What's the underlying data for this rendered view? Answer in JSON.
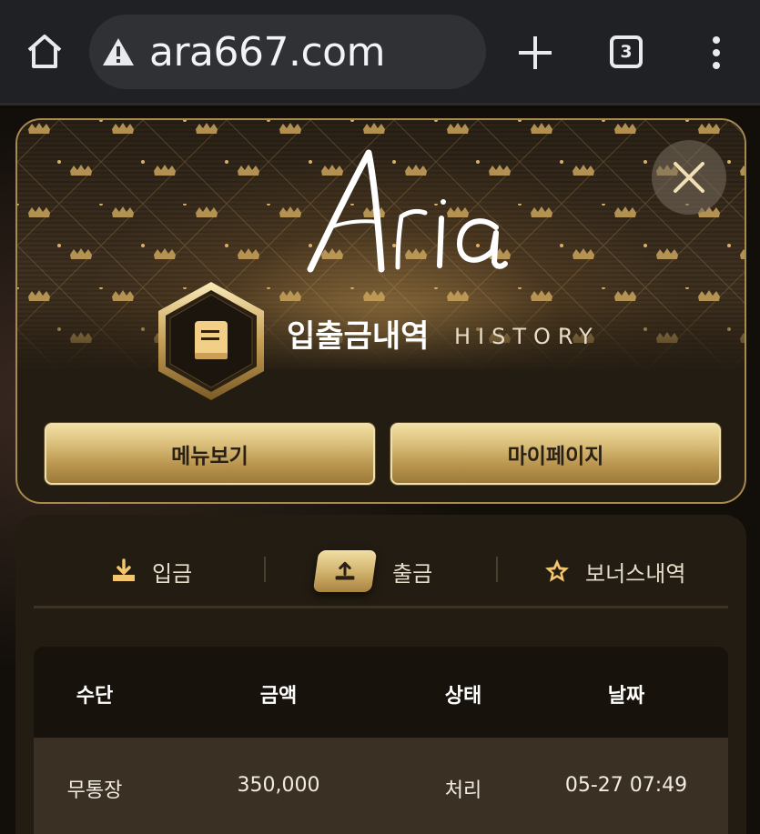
{
  "browser": {
    "url": "ara667.com",
    "tab_count": "3"
  },
  "header": {
    "logo_text": "Aria",
    "title": "입출금내역",
    "subtitle": "HISTORY",
    "menu_button": "메뉴보기",
    "mypage_button": "마이페이지"
  },
  "tabs": [
    {
      "label": "입금",
      "icon": "download-icon",
      "active": false
    },
    {
      "label": "출금",
      "icon": "upload-icon",
      "active": true
    },
    {
      "label": "보너스내역",
      "icon": "star-icon",
      "active": false
    }
  ],
  "table": {
    "headers": [
      "수단",
      "금액",
      "상태",
      "날짜"
    ],
    "rows": [
      [
        "무통장",
        "350,000",
        "처리",
        "05-27 07:49"
      ]
    ]
  },
  "colors": {
    "gold": "#d9bd78",
    "card_bg": "#231c12",
    "row_bg": "#3a3024"
  }
}
